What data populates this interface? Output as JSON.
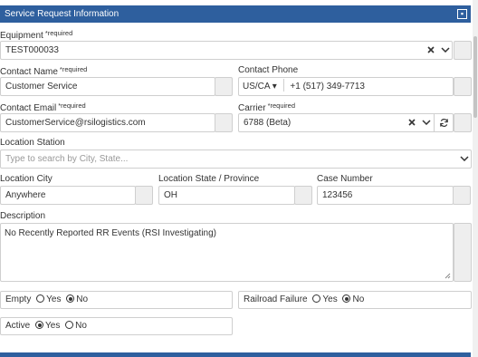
{
  "header": {
    "title": "Service Request Information"
  },
  "required_tag": "*required",
  "equipment": {
    "label": "Equipment",
    "value": "TEST000033"
  },
  "contact_name": {
    "label": "Contact Name",
    "value": "Customer Service"
  },
  "contact_phone": {
    "label": "Contact Phone",
    "country": "US/CA",
    "value": "+1 (517) 349-7713"
  },
  "contact_email": {
    "label": "Contact Email",
    "value": "CustomerService@rsilogistics.com"
  },
  "carrier": {
    "label": "Carrier",
    "value": "6788 (Beta)"
  },
  "location_station": {
    "label": "Location Station",
    "placeholder": "Type to search by City, State..."
  },
  "location_city": {
    "label": "Location City",
    "value": "Anywhere"
  },
  "location_state": {
    "label": "Location State / Province",
    "value": "OH"
  },
  "case_number": {
    "label": "Case Number",
    "value": "123456"
  },
  "description": {
    "label": "Description",
    "value": "No Recently Reported RR Events (RSI Investigating)"
  },
  "empty": {
    "label": "Empty",
    "options": [
      "Yes",
      "No"
    ],
    "selected": "No"
  },
  "railroad_failure": {
    "label": "Railroad Failure",
    "options": [
      "Yes",
      "No"
    ],
    "selected": "No"
  },
  "active": {
    "label": "Active",
    "options": [
      "Yes",
      "No"
    ],
    "selected": "Yes"
  },
  "colors": {
    "header": "#2e5f9e",
    "border": "#cfcfcf",
    "text": "#333333"
  },
  "icons": [
    "clear-icon",
    "chevron-down-icon",
    "refresh-icon",
    "resize-grip-icon"
  ]
}
